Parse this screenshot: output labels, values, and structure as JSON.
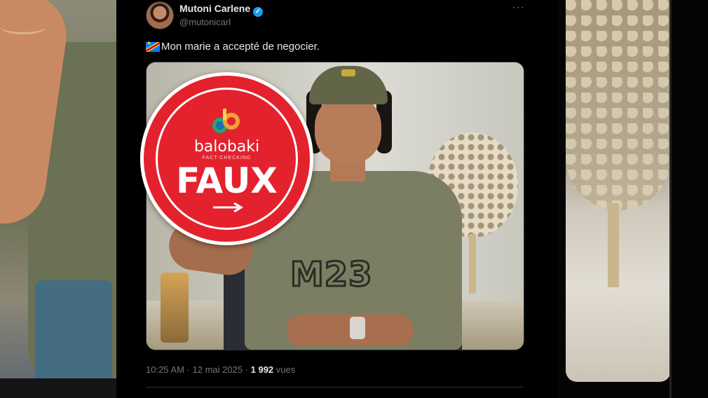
{
  "tweet": {
    "author_name": "Mutoni Carlene",
    "handle": "@mutonicarl",
    "more_label": "···",
    "text": "Mon marie a accepté de negocier.",
    "time": "10:25 AM",
    "dot": " · ",
    "date": "12 mai 2025",
    "views_count": "1 992",
    "views_label": " vues"
  },
  "image": {
    "shirt_text": "M23"
  },
  "fact_check": {
    "brand": "balobaki",
    "tagline": "FACT-CHECKING",
    "verdict": "FAUX",
    "color": "#e3222e"
  },
  "colors": {
    "verified": "#1d9bf0",
    "background": "#000000",
    "muted": "#71767b"
  }
}
